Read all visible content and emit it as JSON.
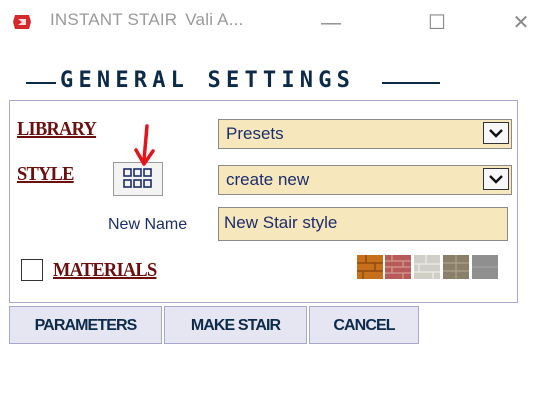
{
  "window": {
    "title": "INSTANT STAIR",
    "subtitle": "Vali A...",
    "minimize_glyph": "—",
    "maximize_glyph": "☐",
    "close_glyph": "✕",
    "app_icon": "sketchup-icon"
  },
  "section": {
    "title": "GENERAL SETTINGS"
  },
  "library": {
    "label": "LIBRARY",
    "value": "Presets"
  },
  "style": {
    "label": "STYLE",
    "value": "create new",
    "grid_icon": "grid-icon",
    "annotation_icon": "red-arrow-icon"
  },
  "new_name": {
    "label": "New Name",
    "value": "New Stair style"
  },
  "materials": {
    "label": "MATERIALS",
    "checked": false,
    "swatch_colors": [
      "#c7701c",
      "#b85a57",
      "#cfcfc6",
      "#8a7f68",
      "#8f8f8f"
    ]
  },
  "buttons": {
    "parameters": "PARAMETERS",
    "make_stair": "MAKE STAIR",
    "cancel": "CANCEL"
  },
  "colors": {
    "header_navy": "#0c2a4a",
    "label_maroon": "#6b0f0f",
    "field_bg": "#f6e7bd",
    "button_bg": "#e6e6f3"
  }
}
